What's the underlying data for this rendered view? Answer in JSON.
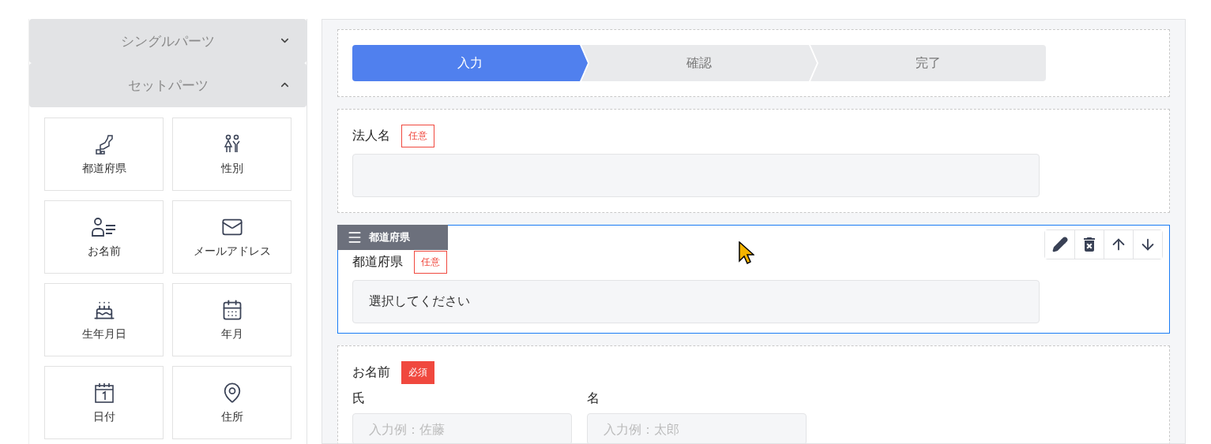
{
  "sidebar": {
    "sections": [
      {
        "title": "シングルパーツ",
        "expanded": false
      },
      {
        "title": "セットパーツ",
        "expanded": true,
        "parts": [
          {
            "label": "都道府県"
          },
          {
            "label": "性別"
          },
          {
            "label": "お名前"
          },
          {
            "label": "メールアドレス"
          },
          {
            "label": "生年月日"
          },
          {
            "label": "年月"
          },
          {
            "label": "日付"
          },
          {
            "label": "住所"
          }
        ]
      }
    ]
  },
  "steps": [
    {
      "label": "入力",
      "selected": true
    },
    {
      "label": "確認",
      "selected": false
    },
    {
      "label": "完了",
      "selected": false
    }
  ],
  "form_blocks": [
    {
      "kind": "text",
      "label": "法人名",
      "required": false,
      "badge": "任意",
      "selected": false
    },
    {
      "kind": "select",
      "label": "都道府県",
      "required": false,
      "badge": "任意",
      "selected": true,
      "handle_label": "都道府県",
      "value": "選択してください"
    },
    {
      "kind": "name",
      "label": "お名前",
      "required": true,
      "badge": "必須",
      "selected": false,
      "subfields": [
        {
          "label": "氏",
          "placeholder": "入力例：佐藤"
        },
        {
          "label": "名",
          "placeholder": "入力例：太郎"
        }
      ]
    }
  ]
}
